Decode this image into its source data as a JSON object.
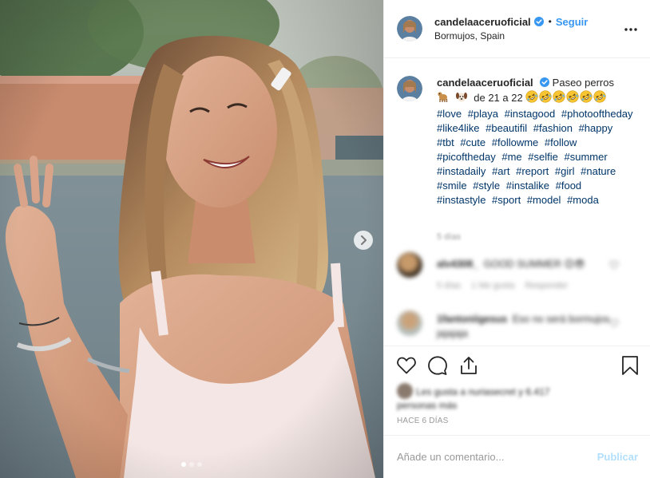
{
  "post": {
    "username": "candelaaceruoficial",
    "verified": true,
    "location": "Bormujos, Spain",
    "follow_label": "Seguir",
    "separator": "•"
  },
  "caption": {
    "username": "candelaaceruoficial",
    "text_before_emojis": "Paseo perros",
    "text_after_emojis": "de 21 a 22",
    "emoji_icons": [
      "dog-emoji",
      "puppy-emoji",
      "rofl-emoji",
      "rofl-emoji",
      "rofl-emoji",
      "rofl-emoji",
      "rofl-emoji",
      "rofl-emoji"
    ],
    "hashtags": [
      "#love",
      "#playa",
      "#instagood",
      "#photooftheday",
      "#like4like",
      "#beautifil",
      "#fashion",
      "#happy",
      "#tbt",
      "#cute",
      "#followme",
      "#follow",
      "#picoftheday",
      "#me",
      "#selfie",
      "#summer",
      "#instadaily",
      "#art",
      "#report",
      "#girl",
      "#nature",
      "#smile",
      "#style",
      "#instalike",
      "#food",
      "#instastyle",
      "#sport",
      "#model",
      "#moda"
    ],
    "ago": "5 días"
  },
  "comments": [
    {
      "username": "alv4308_",
      "text": "GOOD SUMMER 😊😎",
      "ago": "5 días",
      "likes": "1 Me gusta",
      "reply_label": "Responder"
    },
    {
      "username": "1fantoniigesus",
      "text": "Eso no será bormujos jajajaja"
    }
  ],
  "likes_text": "Les gusta a nuriasecret y 6.417 personas más",
  "timestamp": "HACE 6 DÍAS",
  "comment_box": {
    "placeholder": "Añade un comentario...",
    "publish_label": "Publicar"
  },
  "carousel": {
    "total": 3,
    "current": 1
  },
  "colors": {
    "link": "#003569",
    "follow": "#3897f0",
    "publish_disabled": "#b2dffc",
    "verified": "#3897f0",
    "muted": "#999999"
  }
}
